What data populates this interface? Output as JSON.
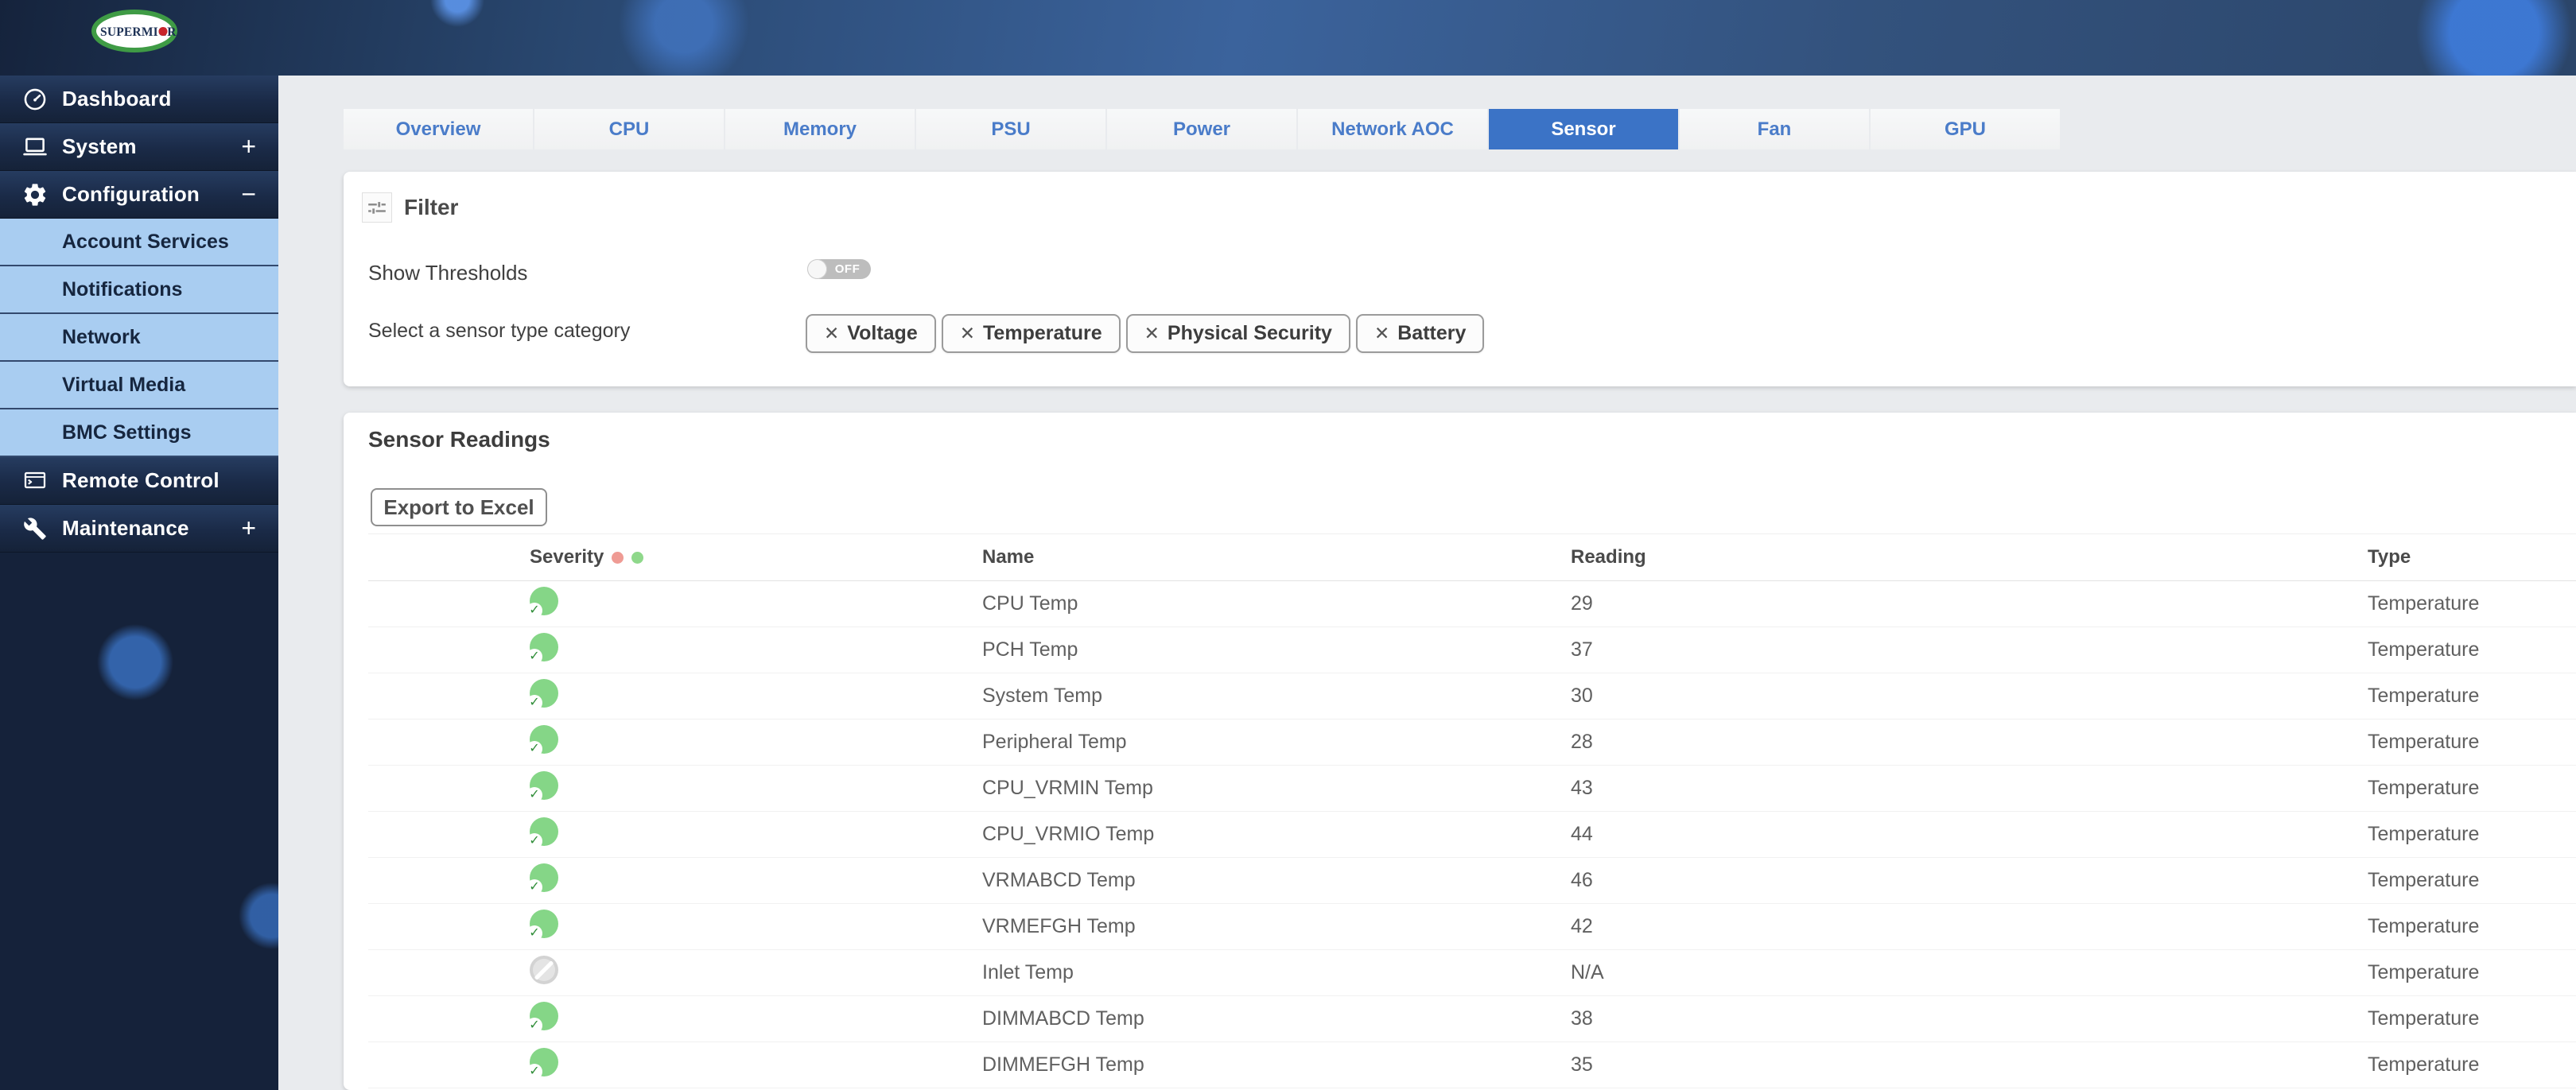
{
  "brand": {
    "logo_text": "SUPERMICR",
    "logo_dot": "red-dot"
  },
  "sidebar": {
    "items": [
      {
        "label": "Dashboard",
        "icon": "gauge-icon",
        "expand": ""
      },
      {
        "label": "System",
        "icon": "laptop-icon",
        "expand": "+"
      },
      {
        "label": "Configuration",
        "icon": "gear-icon",
        "expand": "−"
      },
      {
        "label": "Remote Control",
        "icon": "terminal-icon",
        "expand": ""
      },
      {
        "label": "Maintenance",
        "icon": "wrench-icon",
        "expand": "+"
      }
    ],
    "subitems": [
      {
        "label": "Account Services"
      },
      {
        "label": "Notifications"
      },
      {
        "label": "Network"
      },
      {
        "label": "Virtual Media"
      },
      {
        "label": "BMC Settings"
      }
    ]
  },
  "tabs": [
    {
      "label": "Overview",
      "state": ""
    },
    {
      "label": "CPU",
      "state": ""
    },
    {
      "label": "Memory",
      "state": ""
    },
    {
      "label": "PSU",
      "state": ""
    },
    {
      "label": "Power",
      "state": ""
    },
    {
      "label": "Network AOC",
      "state": ""
    },
    {
      "label": "Sensor",
      "state": "active"
    },
    {
      "label": "Fan",
      "state": ""
    },
    {
      "label": "GPU",
      "state": ""
    }
  ],
  "filter": {
    "title": "Filter",
    "show_thresholds_label": "Show Thresholds",
    "toggle_state": "OFF",
    "category_label": "Select a sensor type category",
    "chips": [
      {
        "label": "Voltage"
      },
      {
        "label": "Temperature"
      },
      {
        "label": "Physical Security"
      },
      {
        "label": "Battery"
      }
    ]
  },
  "readings": {
    "title": "Sensor Readings",
    "export_label": "Export to Excel",
    "columns": [
      "Severity",
      "Name",
      "Reading",
      "Type"
    ],
    "rows": [
      {
        "state": "ok",
        "name": "CPU Temp",
        "reading": "29",
        "type": "Temperature"
      },
      {
        "state": "ok",
        "name": "PCH Temp",
        "reading": "37",
        "type": "Temperature"
      },
      {
        "state": "ok",
        "name": "System Temp",
        "reading": "30",
        "type": "Temperature"
      },
      {
        "state": "ok",
        "name": "Peripheral Temp",
        "reading": "28",
        "type": "Temperature"
      },
      {
        "state": "ok",
        "name": "CPU_VRMIN Temp",
        "reading": "43",
        "type": "Temperature"
      },
      {
        "state": "ok",
        "name": "CPU_VRMIO Temp",
        "reading": "44",
        "type": "Temperature"
      },
      {
        "state": "ok",
        "name": "VRMABCD Temp",
        "reading": "46",
        "type": "Temperature"
      },
      {
        "state": "ok",
        "name": "VRMEFGH Temp",
        "reading": "42",
        "type": "Temperature"
      },
      {
        "state": "na",
        "name": "Inlet Temp",
        "reading": "N/A",
        "type": "Temperature"
      },
      {
        "state": "ok",
        "name": "DIMMABCD Temp",
        "reading": "38",
        "type": "Temperature"
      },
      {
        "state": "ok",
        "name": "DIMMEFGH Temp",
        "reading": "35",
        "type": "Temperature"
      }
    ]
  },
  "icons": {
    "remove": "✕",
    "check": "✓"
  },
  "colors": {
    "accent": "#3b73c6",
    "tab-text": "#4a7cc9",
    "page-bg": "#e9ebee",
    "sidebar-bg": "#15223a",
    "subnav-bg": "#a9cdf1",
    "subnav-text": "#16263f",
    "status-ok": "#85d687",
    "status-ok-check": "#2f8d38",
    "status-na": "#d3d3d3",
    "dot-critical": "#ef9b94",
    "dot-ok": "#8fd88b",
    "logo-green": "#3f9b45",
    "logo-red": "#c9252b",
    "toggle-off": "#bdbdbd"
  }
}
